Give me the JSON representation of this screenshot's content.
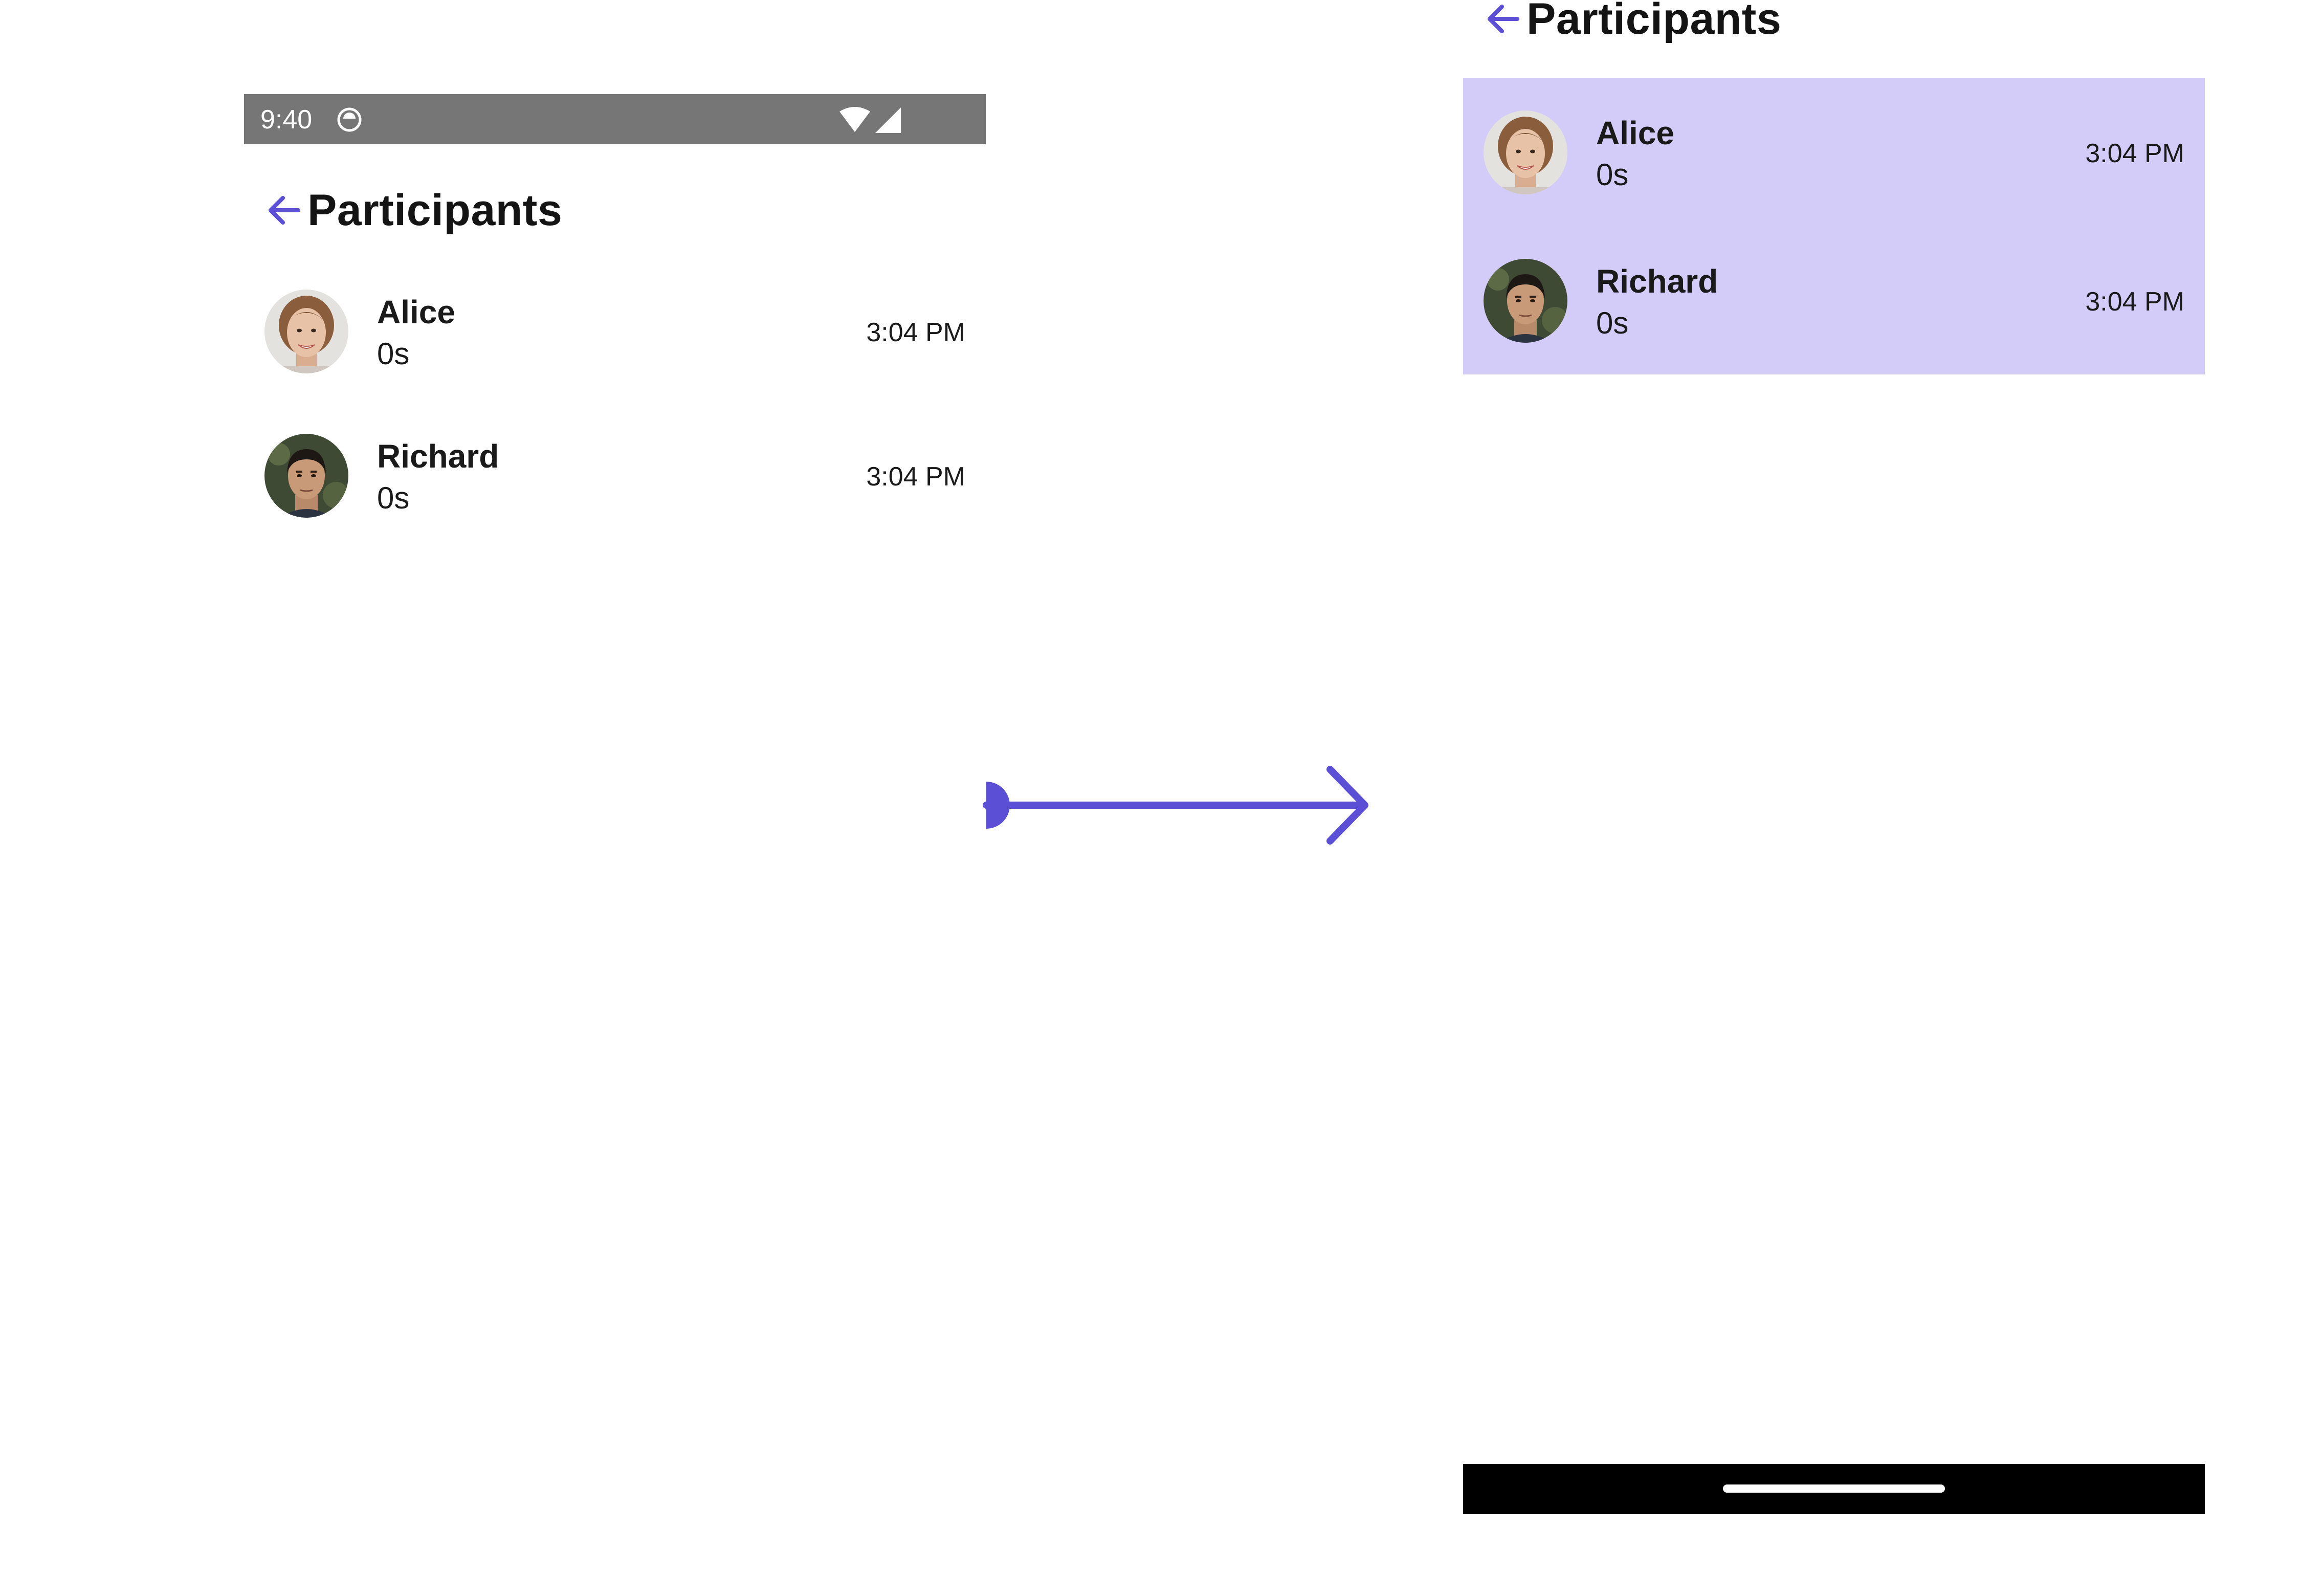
{
  "status_bar": {
    "time": "9:40",
    "icons": [
      "app-notification-icon",
      "wifi-icon",
      "cellular-signal-icon"
    ]
  },
  "screen": {
    "title": "Participants",
    "back_icon": "arrow-back-icon"
  },
  "participants": [
    {
      "name": "Alice",
      "duration": "0s",
      "time": "3:04 PM"
    },
    {
      "name": "Richard",
      "duration": "0s",
      "time": "3:04 PM"
    }
  ],
  "colors": {
    "accent": "#5b4fd6",
    "status_bar_bg": "#767676",
    "selection_bg": "#d4ccf8",
    "nav_bar_bg": "#000000",
    "text": "#1a1a1a"
  }
}
